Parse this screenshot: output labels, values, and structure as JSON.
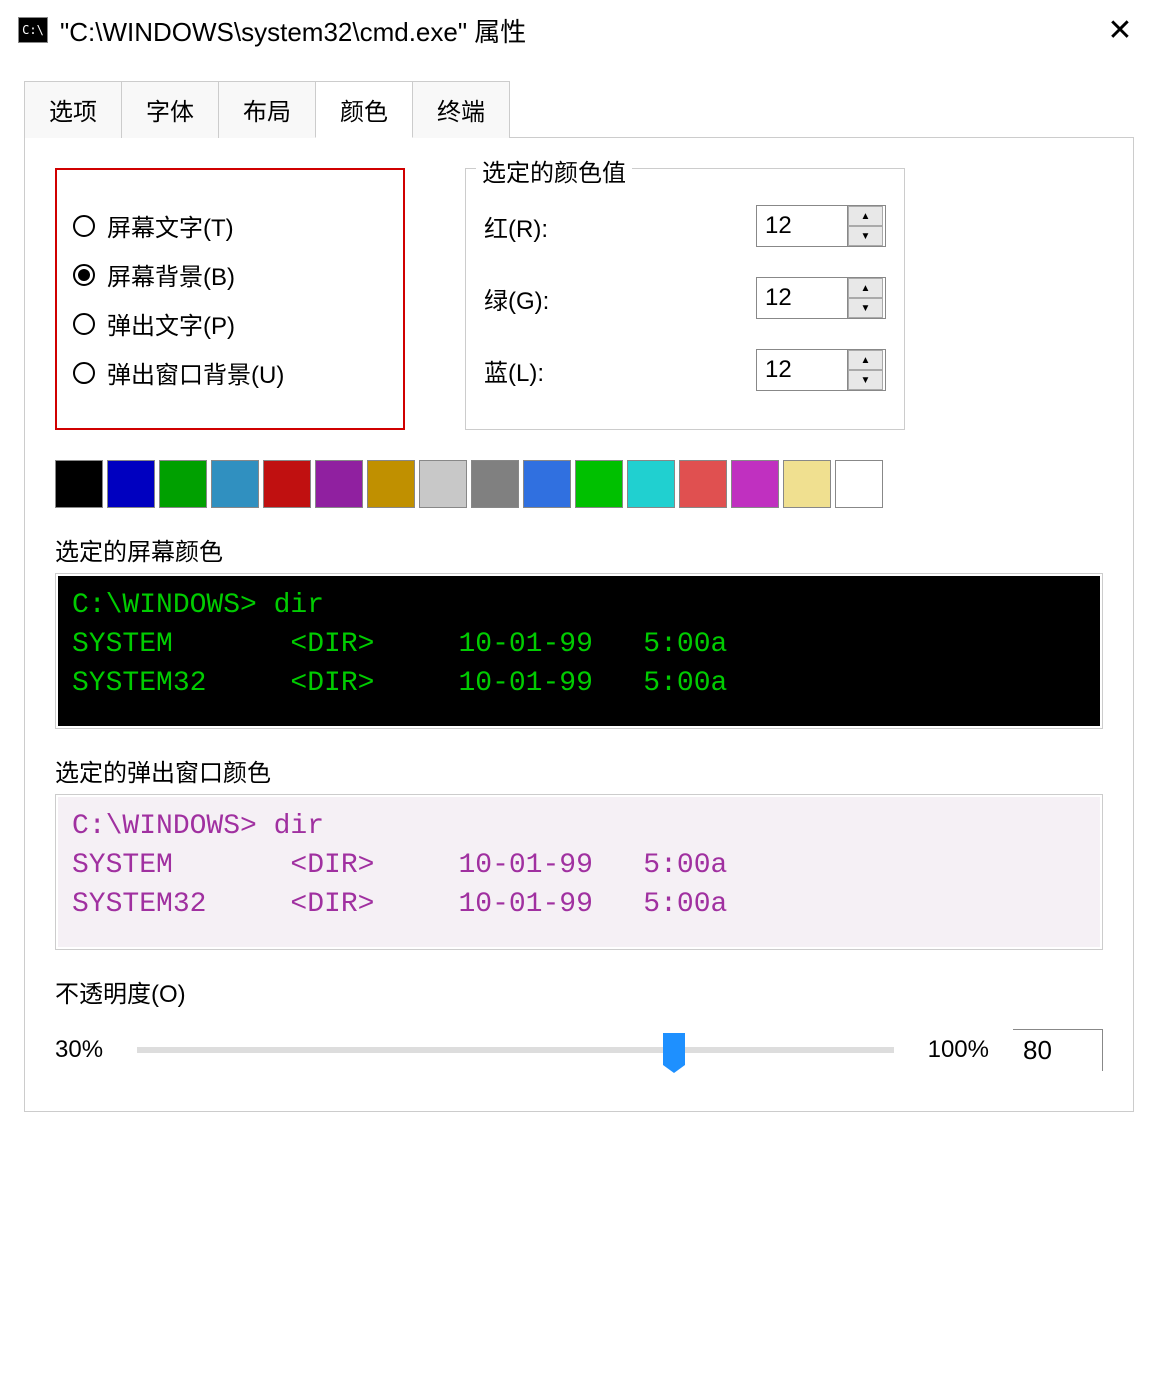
{
  "titlebar": {
    "icon_text": "C:\\",
    "title": "\"C:\\WINDOWS\\system32\\cmd.exe\" 属性"
  },
  "tabs": {
    "options": "选项",
    "font": "字体",
    "layout": "布局",
    "colors": "颜色",
    "terminal": "终端"
  },
  "radios": {
    "screen_text": "屏幕文字(T)",
    "screen_bg": "屏幕背景(B)",
    "popup_text": "弹出文字(P)",
    "popup_bg": "弹出窗口背景(U)",
    "selected": "screen_bg"
  },
  "color_values": {
    "legend": "选定的颜色值",
    "red_label": "红(R):",
    "red_value": "12",
    "green_label": "绿(G):",
    "green_value": "12",
    "blue_label": "蓝(L):",
    "blue_value": "12"
  },
  "palette": [
    "#000000",
    "#0000c0",
    "#00a000",
    "#3090c0",
    "#c01010",
    "#9020a0",
    "#c09000",
    "#c8c8c8",
    "#808080",
    "#3070e0",
    "#00c000",
    "#20d0d0",
    "#e05050",
    "#c030c0",
    "#f0e090",
    "#ffffff"
  ],
  "preview_screen": {
    "label": "选定的屏幕颜色",
    "line1": "C:\\WINDOWS> dir",
    "line2": "SYSTEM       <DIR>     10-01-99   5:00a",
    "line3": "SYSTEM32     <DIR>     10-01-99   5:00a"
  },
  "preview_popup": {
    "label": "选定的弹出窗口颜色",
    "line1": "C:\\WINDOWS> dir",
    "line2": "SYSTEM       <DIR>     10-01-99   5:00a",
    "line3": "SYSTEM32     <DIR>     10-01-99   5:00a"
  },
  "opacity": {
    "label": "不透明度(O)",
    "min_label": "30%",
    "max_label": "100%",
    "value": "80",
    "thumb_percent": 71
  }
}
